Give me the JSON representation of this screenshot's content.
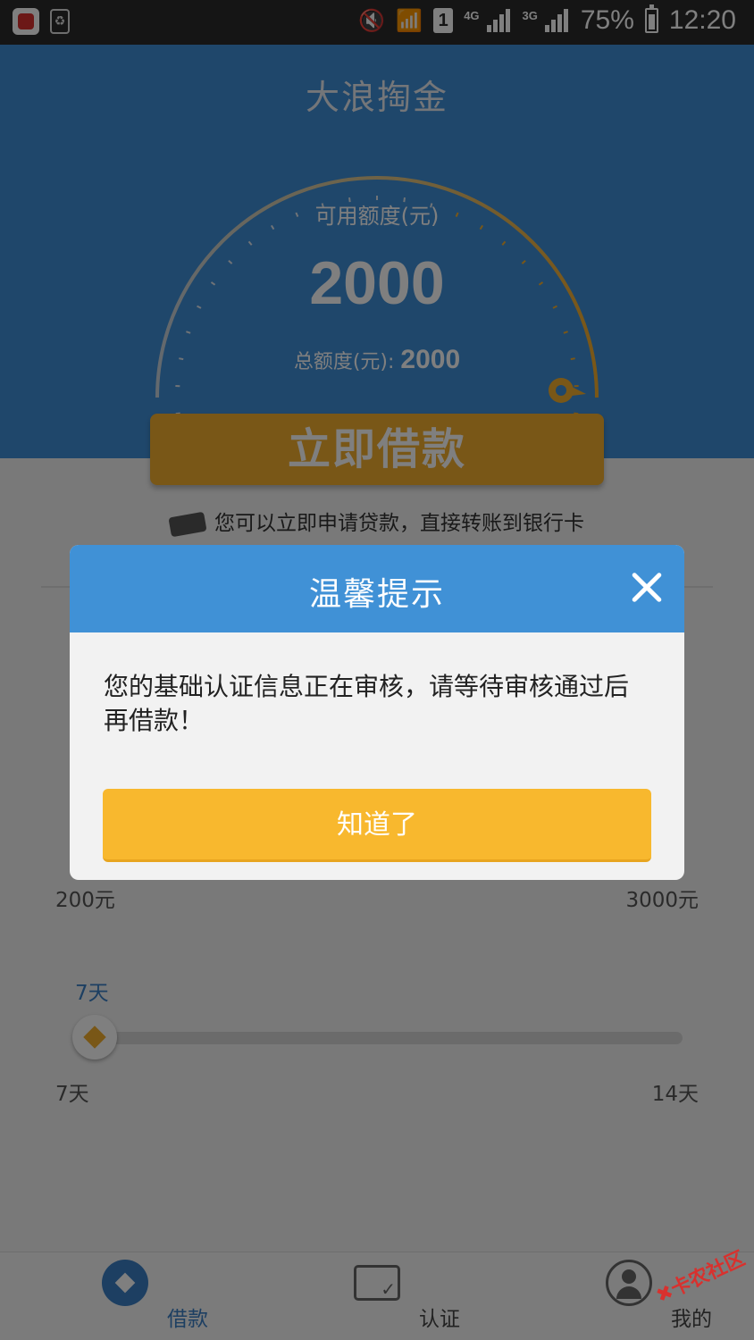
{
  "status_bar": {
    "battery": "75%",
    "time": "12:20",
    "net_primary": "4G",
    "net_secondary": "3G",
    "sim": "1"
  },
  "header": {
    "app_title": "大浪掏金",
    "available_label": "可用额度(元)",
    "available_value": "2000",
    "total_label": "总额度(元):",
    "total_value": "2000"
  },
  "main": {
    "borrow_button": "立即借款",
    "hint": "您可以立即申请贷款，直接转账到银行卡",
    "amount_min": "200元",
    "amount_max": "3000元",
    "days_current": "7天",
    "days_min": "7天",
    "days_max": "14天",
    "days_slider_value": 0
  },
  "dialog": {
    "title": "温馨提示",
    "message": "您的基础认证信息正在审核，请等待审核通过后再借款！",
    "confirm": "知道了"
  },
  "tabbar": {
    "items": [
      {
        "label": "借款",
        "icon": "loan-icon",
        "active": true
      },
      {
        "label": "认证",
        "icon": "certification-icon",
        "active": false
      },
      {
        "label": "我的",
        "icon": "profile-icon",
        "active": false
      }
    ]
  },
  "colors": {
    "primary_blue": "#3f8ed6",
    "accent_orange": "#f3ae2f",
    "dialog_button": "#f8b82e"
  }
}
